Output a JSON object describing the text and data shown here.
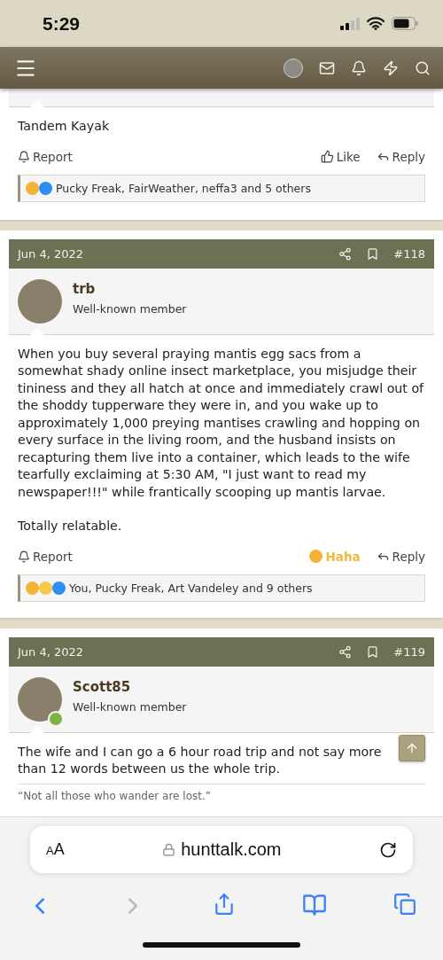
{
  "status_bar": {
    "time": "5:29"
  },
  "posts": [
    {
      "body": [
        "Tandem Kayak"
      ],
      "actions": {
        "report": "Report",
        "react": {
          "label": "Like",
          "selected": false
        },
        "reply": "Reply"
      },
      "reactions": {
        "icons": [
          {
            "color": "#f5b335"
          },
          {
            "color": "#2f8cf0"
          }
        ],
        "text": "Pucky Freak, FairWeather, neffa3 and 5 others"
      }
    },
    {
      "header": {
        "date": "Jun 4, 2022",
        "number": "#118"
      },
      "author": {
        "name": "trb",
        "title": "Well-known member",
        "online": false
      },
      "body": [
        "When you buy several praying mantis egg sacs from a somewhat shady online insect marketplace, you misjudge their tininess and they all hatch at once and immediately crawl out of the shoddy tupperware they were in, and you wake up to approximately 1,000 preying mantises crawling and hopping on every surface in the living room, and the husband insists on recapturing them live into a container, which leads to the wife tearfully exclaiming at 5:30 AM, \"I just want to read my newspaper!!!\" while frantically scooping up mantis larvae.",
        "Totally relatable."
      ],
      "actions": {
        "report": "Report",
        "react": {
          "label": "Haha",
          "selected": true
        },
        "reply": "Reply"
      },
      "reactions": {
        "icons": [
          {
            "color": "#f5b335"
          },
          {
            "color": "#f7c948"
          },
          {
            "color": "#2f8cf0"
          }
        ],
        "text": "You, Pucky Freak, Art Vandeley and 9 others"
      }
    },
    {
      "header": {
        "date": "Jun 4, 2022",
        "number": "#119"
      },
      "author": {
        "name": "Scott85",
        "title": "Well-known member",
        "online": true
      },
      "body": [
        "The wife and I can go a 6 hour road trip and not say more than 12 words between us the whole trip."
      ],
      "signature": "“Not all those who wander are lost.”"
    }
  ],
  "browser": {
    "text_size": "AA",
    "url": "hunttalk.com"
  }
}
